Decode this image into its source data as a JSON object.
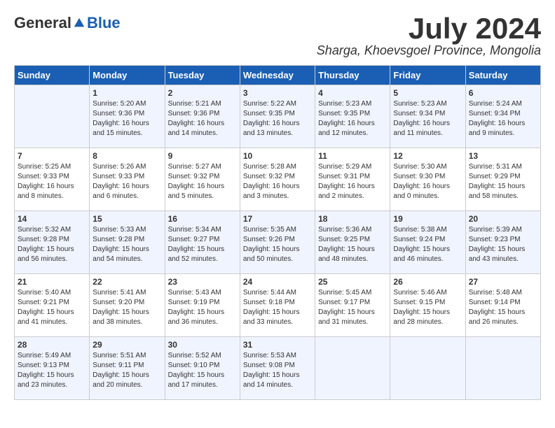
{
  "logo": {
    "general": "General",
    "blue": "Blue"
  },
  "title": "July 2024",
  "location": "Sharga, Khoevsgoel Province, Mongolia",
  "days_of_week": [
    "Sunday",
    "Monday",
    "Tuesday",
    "Wednesday",
    "Thursday",
    "Friday",
    "Saturday"
  ],
  "weeks": [
    [
      {
        "day": "",
        "info": ""
      },
      {
        "day": "1",
        "info": "Sunrise: 5:20 AM\nSunset: 9:36 PM\nDaylight: 16 hours\nand 15 minutes."
      },
      {
        "day": "2",
        "info": "Sunrise: 5:21 AM\nSunset: 9:36 PM\nDaylight: 16 hours\nand 14 minutes."
      },
      {
        "day": "3",
        "info": "Sunrise: 5:22 AM\nSunset: 9:35 PM\nDaylight: 16 hours\nand 13 minutes."
      },
      {
        "day": "4",
        "info": "Sunrise: 5:23 AM\nSunset: 9:35 PM\nDaylight: 16 hours\nand 12 minutes."
      },
      {
        "day": "5",
        "info": "Sunrise: 5:23 AM\nSunset: 9:34 PM\nDaylight: 16 hours\nand 11 minutes."
      },
      {
        "day": "6",
        "info": "Sunrise: 5:24 AM\nSunset: 9:34 PM\nDaylight: 16 hours\nand 9 minutes."
      }
    ],
    [
      {
        "day": "7",
        "info": "Sunrise: 5:25 AM\nSunset: 9:33 PM\nDaylight: 16 hours\nand 8 minutes."
      },
      {
        "day": "8",
        "info": "Sunrise: 5:26 AM\nSunset: 9:33 PM\nDaylight: 16 hours\nand 6 minutes."
      },
      {
        "day": "9",
        "info": "Sunrise: 5:27 AM\nSunset: 9:32 PM\nDaylight: 16 hours\nand 5 minutes."
      },
      {
        "day": "10",
        "info": "Sunrise: 5:28 AM\nSunset: 9:32 PM\nDaylight: 16 hours\nand 3 minutes."
      },
      {
        "day": "11",
        "info": "Sunrise: 5:29 AM\nSunset: 9:31 PM\nDaylight: 16 hours\nand 2 minutes."
      },
      {
        "day": "12",
        "info": "Sunrise: 5:30 AM\nSunset: 9:30 PM\nDaylight: 16 hours\nand 0 minutes."
      },
      {
        "day": "13",
        "info": "Sunrise: 5:31 AM\nSunset: 9:29 PM\nDaylight: 15 hours\nand 58 minutes."
      }
    ],
    [
      {
        "day": "14",
        "info": "Sunrise: 5:32 AM\nSunset: 9:28 PM\nDaylight: 15 hours\nand 56 minutes."
      },
      {
        "day": "15",
        "info": "Sunrise: 5:33 AM\nSunset: 9:28 PM\nDaylight: 15 hours\nand 54 minutes."
      },
      {
        "day": "16",
        "info": "Sunrise: 5:34 AM\nSunset: 9:27 PM\nDaylight: 15 hours\nand 52 minutes."
      },
      {
        "day": "17",
        "info": "Sunrise: 5:35 AM\nSunset: 9:26 PM\nDaylight: 15 hours\nand 50 minutes."
      },
      {
        "day": "18",
        "info": "Sunrise: 5:36 AM\nSunset: 9:25 PM\nDaylight: 15 hours\nand 48 minutes."
      },
      {
        "day": "19",
        "info": "Sunrise: 5:38 AM\nSunset: 9:24 PM\nDaylight: 15 hours\nand 46 minutes."
      },
      {
        "day": "20",
        "info": "Sunrise: 5:39 AM\nSunset: 9:23 PM\nDaylight: 15 hours\nand 43 minutes."
      }
    ],
    [
      {
        "day": "21",
        "info": "Sunrise: 5:40 AM\nSunset: 9:21 PM\nDaylight: 15 hours\nand 41 minutes."
      },
      {
        "day": "22",
        "info": "Sunrise: 5:41 AM\nSunset: 9:20 PM\nDaylight: 15 hours\nand 38 minutes."
      },
      {
        "day": "23",
        "info": "Sunrise: 5:43 AM\nSunset: 9:19 PM\nDaylight: 15 hours\nand 36 minutes."
      },
      {
        "day": "24",
        "info": "Sunrise: 5:44 AM\nSunset: 9:18 PM\nDaylight: 15 hours\nand 33 minutes."
      },
      {
        "day": "25",
        "info": "Sunrise: 5:45 AM\nSunset: 9:17 PM\nDaylight: 15 hours\nand 31 minutes."
      },
      {
        "day": "26",
        "info": "Sunrise: 5:46 AM\nSunset: 9:15 PM\nDaylight: 15 hours\nand 28 minutes."
      },
      {
        "day": "27",
        "info": "Sunrise: 5:48 AM\nSunset: 9:14 PM\nDaylight: 15 hours\nand 26 minutes."
      }
    ],
    [
      {
        "day": "28",
        "info": "Sunrise: 5:49 AM\nSunset: 9:13 PM\nDaylight: 15 hours\nand 23 minutes."
      },
      {
        "day": "29",
        "info": "Sunrise: 5:51 AM\nSunset: 9:11 PM\nDaylight: 15 hours\nand 20 minutes."
      },
      {
        "day": "30",
        "info": "Sunrise: 5:52 AM\nSunset: 9:10 PM\nDaylight: 15 hours\nand 17 minutes."
      },
      {
        "day": "31",
        "info": "Sunrise: 5:53 AM\nSunset: 9:08 PM\nDaylight: 15 hours\nand 14 minutes."
      },
      {
        "day": "",
        "info": ""
      },
      {
        "day": "",
        "info": ""
      },
      {
        "day": "",
        "info": ""
      }
    ]
  ]
}
